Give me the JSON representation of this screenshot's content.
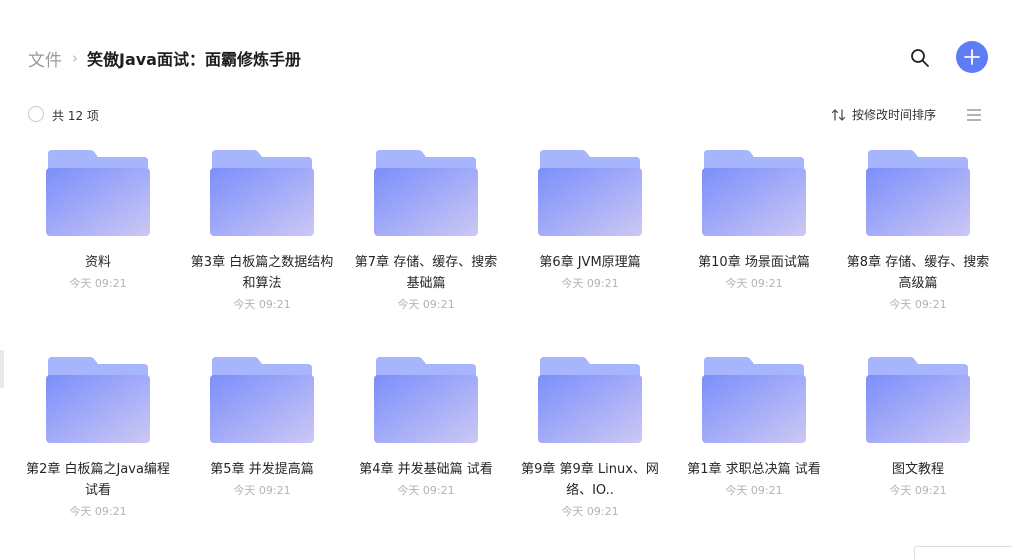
{
  "breadcrumb": {
    "root": "文件",
    "separator": "›",
    "current": "笑傲Java面试：面霸修炼手册"
  },
  "toolbar": {
    "count_label": "共 12 项",
    "sort_label": "按修改时间排序"
  },
  "icons": {
    "search": "search-icon",
    "add": "plus-icon",
    "sort": "sort-arrows-icon",
    "view": "list-view-icon",
    "folder": "folder-icon"
  },
  "colors": {
    "accent": "#5e7cf6",
    "folder_back": "#a6b5fc",
    "folder_front_start": "#7b8ffb",
    "folder_front_end": "#ccc8f4"
  },
  "folders": [
    {
      "name": "资料",
      "time": "今天 09:21"
    },
    {
      "name": "第3章 白板篇之数据结构和算法",
      "time": "今天 09:21"
    },
    {
      "name": "第7章 存储、缓存、搜索基础篇",
      "time": "今天 09:21"
    },
    {
      "name": "第6章 JVM原理篇",
      "time": "今天 09:21"
    },
    {
      "name": "第10章 场景面试篇",
      "time": "今天 09:21"
    },
    {
      "name": "第8章 存储、缓存、搜索高级篇",
      "time": "今天 09:21"
    },
    {
      "name": "第2章 白板篇之Java编程 试看",
      "time": "今天 09:21"
    },
    {
      "name": "第5章 并发提高篇",
      "time": "今天 09:21"
    },
    {
      "name": "第4章 并发基础篇 试看",
      "time": "今天 09:21"
    },
    {
      "name": "第9章 第9章 Linux、网络、IO..",
      "time": "今天 09:21"
    },
    {
      "name": "第1章 求职总决篇 试看",
      "time": "今天 09:21"
    },
    {
      "name": "图文教程",
      "time": "今天 09:21"
    }
  ]
}
